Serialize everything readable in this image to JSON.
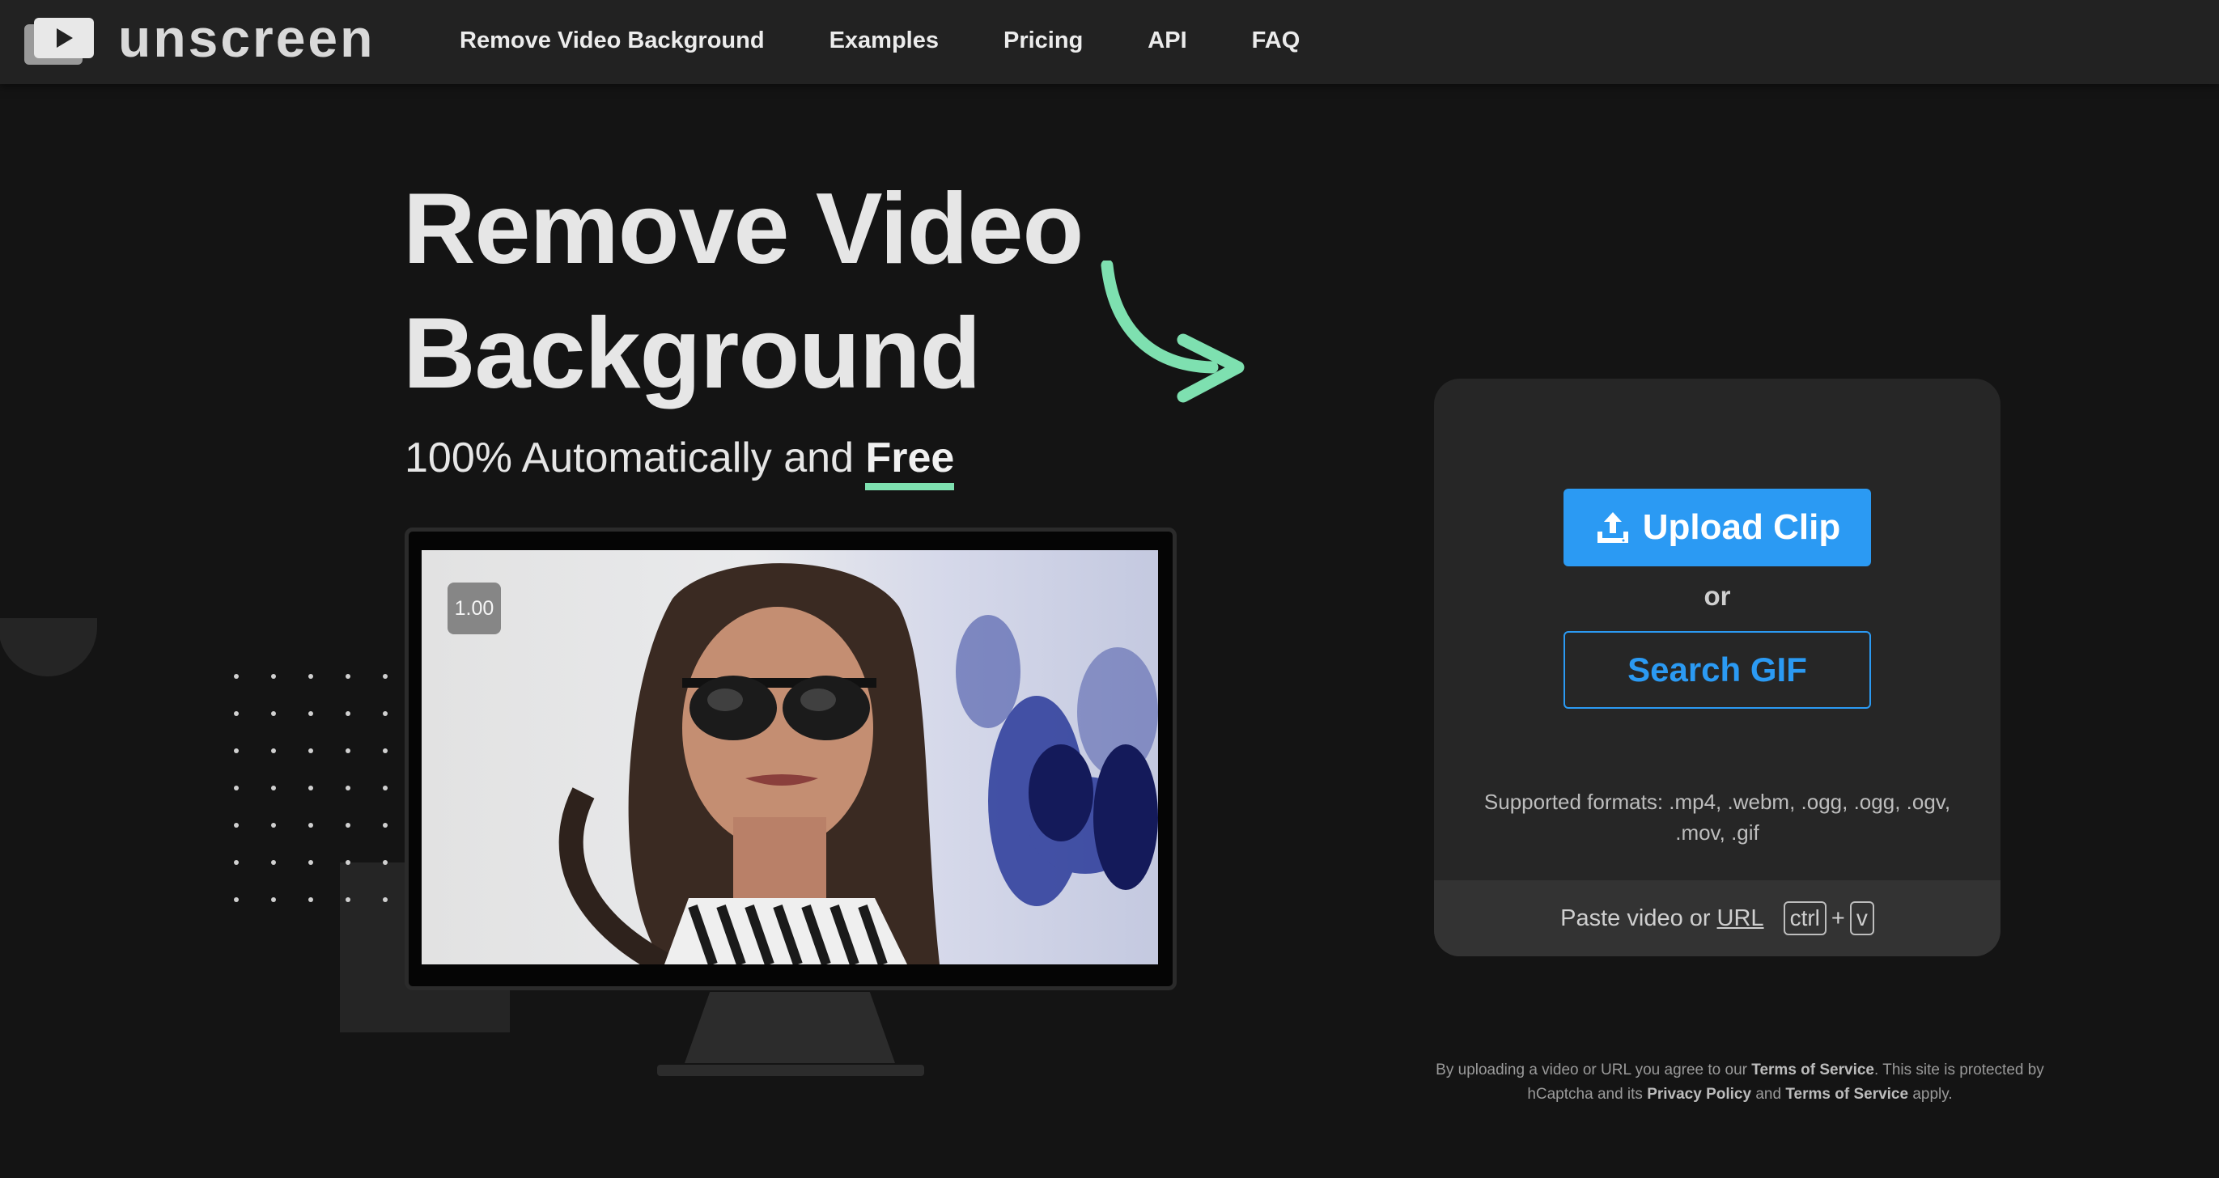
{
  "brand": {
    "name": "unscreen"
  },
  "nav": {
    "items": [
      {
        "label": "Remove Video Background"
      },
      {
        "label": "Examples"
      },
      {
        "label": "Pricing"
      },
      {
        "label": "API"
      },
      {
        "label": "FAQ"
      }
    ]
  },
  "hero": {
    "title_line1": "Remove Video",
    "title_line2": "Background",
    "subtitle_prefix": "100% Automatically and ",
    "subtitle_emphasis": "Free",
    "preview_speed": "1.00"
  },
  "upload": {
    "upload_label": "Upload Clip",
    "or_label": "or",
    "search_label": "Search GIF",
    "formats_text": "Supported formats: .mp4, .webm, .ogg, .ogg, .ogv, .mov, .gif",
    "paste_prefix": "Paste video or",
    "paste_link": "URL",
    "key_ctrl": "ctrl",
    "key_plus": "+",
    "key_v": "v"
  },
  "legal": {
    "t1": "By uploading a video or URL you agree to our ",
    "terms1": "Terms of Service",
    "t2": ". This site is protected by hCaptcha and its ",
    "privacy": "Privacy Policy",
    "t3": " and ",
    "terms2": "Terms of Service",
    "t4": " apply."
  },
  "colors": {
    "accent_blue": "#2b9af3",
    "accent_green": "#7ee0b0",
    "background": "#141414",
    "navbar": "#222222",
    "card": "#262626"
  },
  "icons": {
    "logo": "play-window-icon",
    "upload": "upload-icon",
    "arrow": "curved-arrow-icon"
  }
}
